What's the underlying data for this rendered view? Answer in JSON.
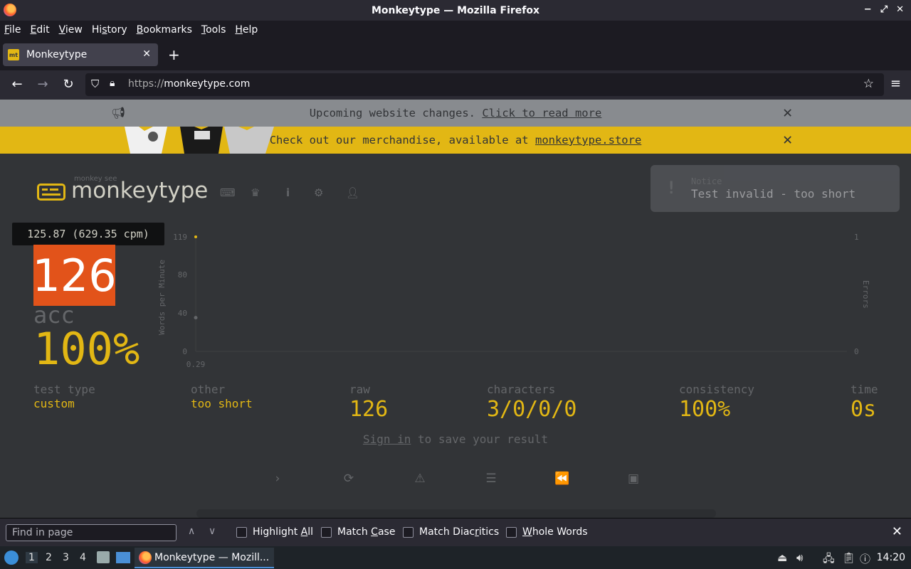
{
  "window": {
    "title": "Monkeytype — Mozilla Firefox",
    "controls": [
      "−",
      "⤢",
      "✕"
    ]
  },
  "menubar": {
    "items": [
      {
        "pre": "",
        "u": "F",
        "post": "ile"
      },
      {
        "pre": "",
        "u": "E",
        "post": "dit"
      },
      {
        "pre": "",
        "u": "V",
        "post": "iew"
      },
      {
        "pre": "Hi",
        "u": "s",
        "post": "tory"
      },
      {
        "pre": "",
        "u": "B",
        "post": "ookmarks"
      },
      {
        "pre": "",
        "u": "T",
        "post": "ools"
      },
      {
        "pre": "",
        "u": "H",
        "post": "elp"
      }
    ]
  },
  "tab": {
    "favicon_text": "mt",
    "label": "Monkeytype",
    "close": "✕",
    "new_tab": "+"
  },
  "nav": {
    "back": "←",
    "forward": "→",
    "reload": "↻",
    "url_scheme": "https://",
    "url_host": "monkeytype.com",
    "bookmark": "☆",
    "menu": "≡"
  },
  "banner1": {
    "text": "Upcoming website changes.",
    "link": "Click to read more",
    "close": "✕"
  },
  "banner2": {
    "text": "Check out our merchandise, available at",
    "link": "monkeytype.store",
    "close": "✕"
  },
  "header": {
    "logo_top": "monkey see",
    "logo_text": "monkeytype"
  },
  "notice": {
    "title": "Notice",
    "message": "Test invalid - too short",
    "icon": "!"
  },
  "result": {
    "tooltip": "125.87 (629.35 cpm)",
    "wpm": "126",
    "acc_label": "acc",
    "acc_value": "100%"
  },
  "chart_data": {
    "type": "line",
    "ylabel": "Words per Minute",
    "y2label": "Errors",
    "yticks": [
      "119",
      "80",
      "40",
      "0"
    ],
    "y2ticks": [
      "1",
      "0"
    ],
    "xticks": [
      "0.29"
    ],
    "ylim": [
      0,
      119
    ],
    "y2lim": [
      0,
      1
    ],
    "series": [
      {
        "x": [
          0.29
        ],
        "values": [
          119
        ]
      },
      {
        "x": [
          0.29
        ],
        "values": [
          35
        ]
      }
    ],
    "colors": {
      "wpm": "#e2b714",
      "raw": "#646669"
    }
  },
  "stats": {
    "test_type_label": "test type",
    "test_type_value": "custom",
    "other_label": "other",
    "other_value": "too short",
    "raw_label": "raw",
    "raw_value": "126",
    "characters_label": "characters",
    "characters_value": "3/0/0/0",
    "consistency_label": "consistency",
    "consistency_value": "100%",
    "time_label": "time",
    "time_value": "0s"
  },
  "signin": {
    "link": "Sign in",
    "text": "to save your result"
  },
  "actions": [
    "›",
    "⟳",
    "⚠",
    "☰",
    "⏪",
    "▣"
  ],
  "findbar": {
    "placeholder": "Find in page",
    "up": "∧",
    "down": "∨",
    "options": [
      {
        "pre": "Highlight ",
        "u": "A",
        "post": "ll"
      },
      {
        "pre": "Match ",
        "u": "C",
        "post": "ase"
      },
      {
        "pre": "Match Diac",
        "u": "r",
        "post": "itics"
      },
      {
        "pre": "",
        "u": "W",
        "post": "hole Words"
      }
    ],
    "close": "✕"
  },
  "taskbar": {
    "workspaces": [
      "1",
      "2",
      "3",
      "4"
    ],
    "task_label": "Monkeytype — Mozill...",
    "clock": "14:20"
  },
  "colors": {
    "bg": "#323437",
    "main": "#e2b714",
    "sub": "#646669",
    "text": "#d1d0c5",
    "wpm_box": "#e2531a"
  }
}
